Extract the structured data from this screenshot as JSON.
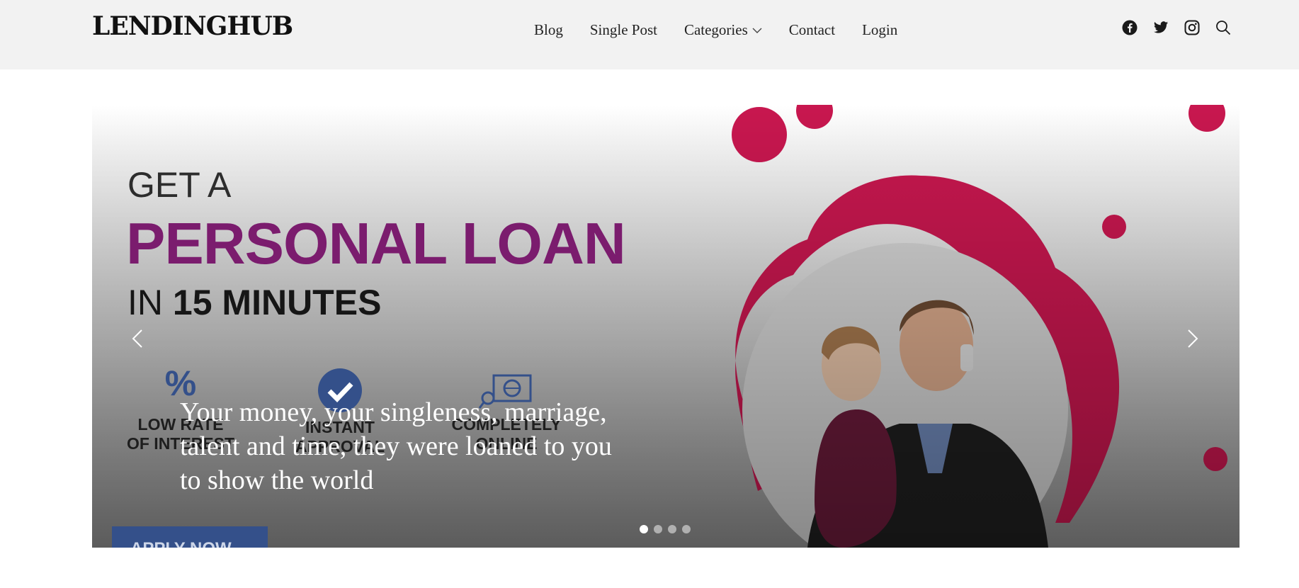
{
  "header": {
    "logo": "LENDINGHUB",
    "nav": [
      {
        "label": "Blog"
      },
      {
        "label": "Single Post"
      },
      {
        "label": "Categories",
        "has_dropdown": true
      },
      {
        "label": "Contact"
      },
      {
        "label": "Login"
      }
    ],
    "social_icons": [
      "facebook-icon",
      "twitter-icon",
      "instagram-icon",
      "search-icon"
    ]
  },
  "slider": {
    "banner": {
      "line1": "GET A",
      "line2": "PERSONAL LOAN",
      "line3_prefix": "IN ",
      "line3_bold": "15 MINUTES",
      "features": [
        {
          "icon": "percent-icon",
          "label1": "LOW RATE",
          "label2": "OF INTEREST"
        },
        {
          "icon": "checkmark-badge-icon",
          "label1": "INSTANT",
          "label2": "APPROVAL"
        },
        {
          "icon": "online-globe-icon",
          "label1": "COMPLETELY",
          "label2": "ONLINE"
        }
      ],
      "apply_label": "APPLY NOW"
    },
    "caption": "Your money, your singleness, marriage, talent and time, they were loaned to you to show the world",
    "slide_count": 4,
    "active_slide": 1
  },
  "colors": {
    "header_bg": "#f2f2f2",
    "accent_purple": "#7b1c6e",
    "accent_crimson": "#c8174f",
    "button_blue": "#34508a"
  }
}
